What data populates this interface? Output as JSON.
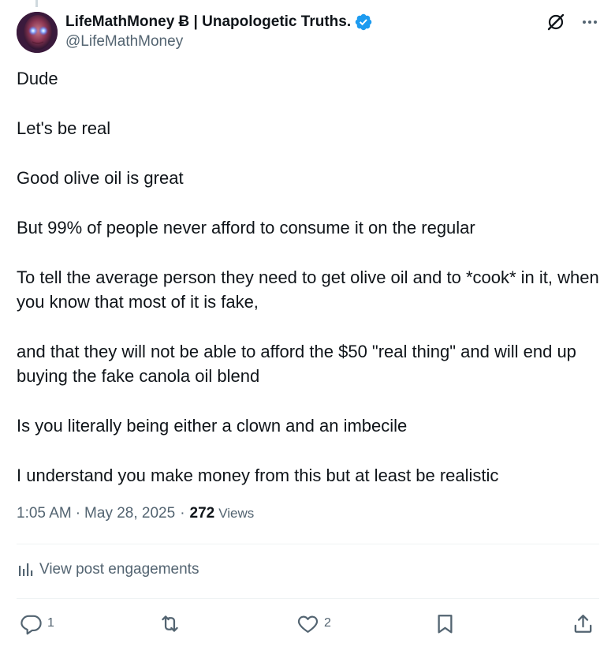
{
  "author": {
    "display_name": "LifeMathMoney Ƀ | Unapologetic Truths.",
    "handle": "@LifeMathMoney",
    "verified": true
  },
  "post": {
    "paragraphs": [
      "Dude",
      "Let's be real",
      "Good olive oil is great",
      "But 99% of people never afford to consume it on the regular",
      "To tell the average person they need to get olive oil and to *cook* in it, when you know that most of it is fake,",
      "and that they will not be able to afford the $50 \"real thing\" and will end up buying the fake canola oil blend",
      "Is you literally being either a clown and an imbecile",
      "I understand you make money from this but at least be realistic"
    ]
  },
  "meta": {
    "time": "1:05 AM",
    "separator": "·",
    "date": "May 28, 2025",
    "views_count": "272",
    "views_label": "Views"
  },
  "engagements": {
    "label": "View post engagements"
  },
  "actions": {
    "replies": "1",
    "reposts": "",
    "likes": "2"
  },
  "icons": {
    "verified": "verified-badge-icon",
    "grok": "grok-icon",
    "more": "more-icon",
    "engagements": "bar-chart-icon",
    "reply": "reply-icon",
    "repost": "repost-icon",
    "like": "heart-icon",
    "bookmark": "bookmark-icon",
    "share": "share-icon"
  },
  "colors": {
    "text_primary": "#0f1419",
    "text_secondary": "#536471",
    "verified_blue": "#1d9bf0",
    "divider": "#eff3f4"
  }
}
